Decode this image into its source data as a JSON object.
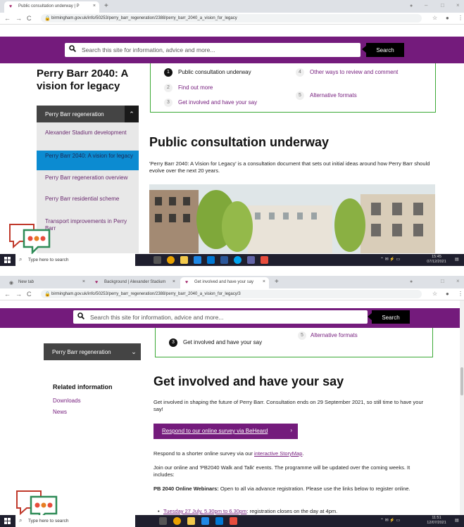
{
  "shot1": {
    "tab_title": "Public consultation underway | P",
    "url": "birmingham.gov.uk/info/50253/perry_barr_regeneration/2388/perry_barr_2040_a_vision_for_legacy",
    "search_placeholder": "Search this site for information, advice and more...",
    "search_button": "Search",
    "page_heading": "Perry Barr 2040: A vision for legacy",
    "section_button": "Perry Barr regeneration",
    "subnav": [
      "Alexander Stadium development",
      "Perry Barr 2040: A vision for legacy",
      "Perry Barr regeneration overview",
      "Perry Barr residential scheme",
      "Transport improvements in Perry Barr"
    ],
    "contents": [
      {
        "num": "1",
        "label": "Public consultation underway"
      },
      {
        "num": "2",
        "label": "Find out more"
      },
      {
        "num": "3",
        "label": "Get involved and have your say"
      },
      {
        "num": "4",
        "label": "Other ways to review and comment"
      },
      {
        "num": "5",
        "label": "Alternative formats"
      }
    ],
    "section_heading": "Public consultation underway",
    "intro": "'Perry Barr 2040: A Vision for Legacy' is a consultation document that sets out initial ideas around how Perry Barr should evolve over the next 20 years.",
    "taskbar_search": "Type here to search",
    "clock_time": "15:45",
    "clock_date": "07/12/2021"
  },
  "shot2": {
    "tabs": [
      "New tab",
      "Background | Alexander Stadium",
      "Get involved and have your say"
    ],
    "url": "birmingham.gov.uk/info/50253/perry_barr_regeneration/2388/perry_barr_2040_a_vision_for_legacy/3",
    "search_placeholder": "Search this site for information, advice and more...",
    "search_button": "Search",
    "section_button": "Perry Barr regeneration",
    "contents_current": "Get involved and have your say",
    "contents_current_num": "3",
    "contents_other": "Alternative formats",
    "contents_other_num": "5",
    "related_heading": "Related information",
    "related_links": [
      "Downloads",
      "News"
    ],
    "section_heading": "Get involved and have your say",
    "intro": "Get involved in shaping the future of Perry Barr. Consultation ends on 29 September 2021, so still time to have your say!",
    "survey_button": "Respond to our online survey via BeHeard",
    "shorter_prefix": "Respond to a shorter online survey via our ",
    "shorter_link": "interactive StoryMap",
    "shorter_suffix": ".",
    "events": "Join our online and 'PB2040 Walk and Talk' events. The programme will be updated over the coming weeks. It includes:",
    "webinars_bold": "PB 2040 Online Webinars:",
    "webinars_rest": " Open to all via advance registration. Please use the links below to register online.",
    "bullet_link": "Tuesday 27 July, 5.30pm to 6.30pm",
    "bullet_rest": ": registration closes on the day at 4pm.",
    "taskbar_search": "Type here to search",
    "clock_time": "11:51",
    "clock_date": "12/07/2021"
  }
}
